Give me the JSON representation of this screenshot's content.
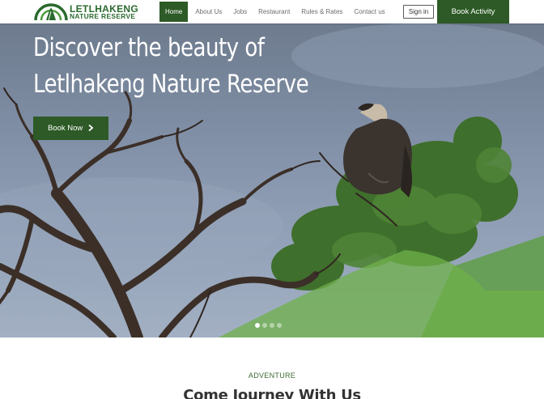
{
  "header": {
    "logo": {
      "line1": "LETLHAKENG",
      "line2": "NATURE RESERVE"
    },
    "nav": [
      {
        "label": "Home",
        "active": true
      },
      {
        "label": "About Us",
        "active": false
      },
      {
        "label": "Jobs",
        "active": false
      },
      {
        "label": "Restaurant",
        "active": false
      },
      {
        "label": "Rules & Rates",
        "active": false
      },
      {
        "label": "Contact us",
        "active": false
      }
    ],
    "signin_label": "Sign in",
    "book_activity_label": "Book Activity"
  },
  "hero": {
    "title_line1": "Discover the beauty of",
    "title_line2": "Letlhakeng Nature Reserve",
    "book_now_label": "Book Now",
    "slide_count": 4,
    "active_slide": 1
  },
  "section": {
    "eyebrow": "ADVENTURE",
    "title": "Come Journey With Us"
  },
  "colors": {
    "brand_green": "#2d5a26",
    "logo_green": "#2a6a2d",
    "sky": "#8b9ab1"
  }
}
